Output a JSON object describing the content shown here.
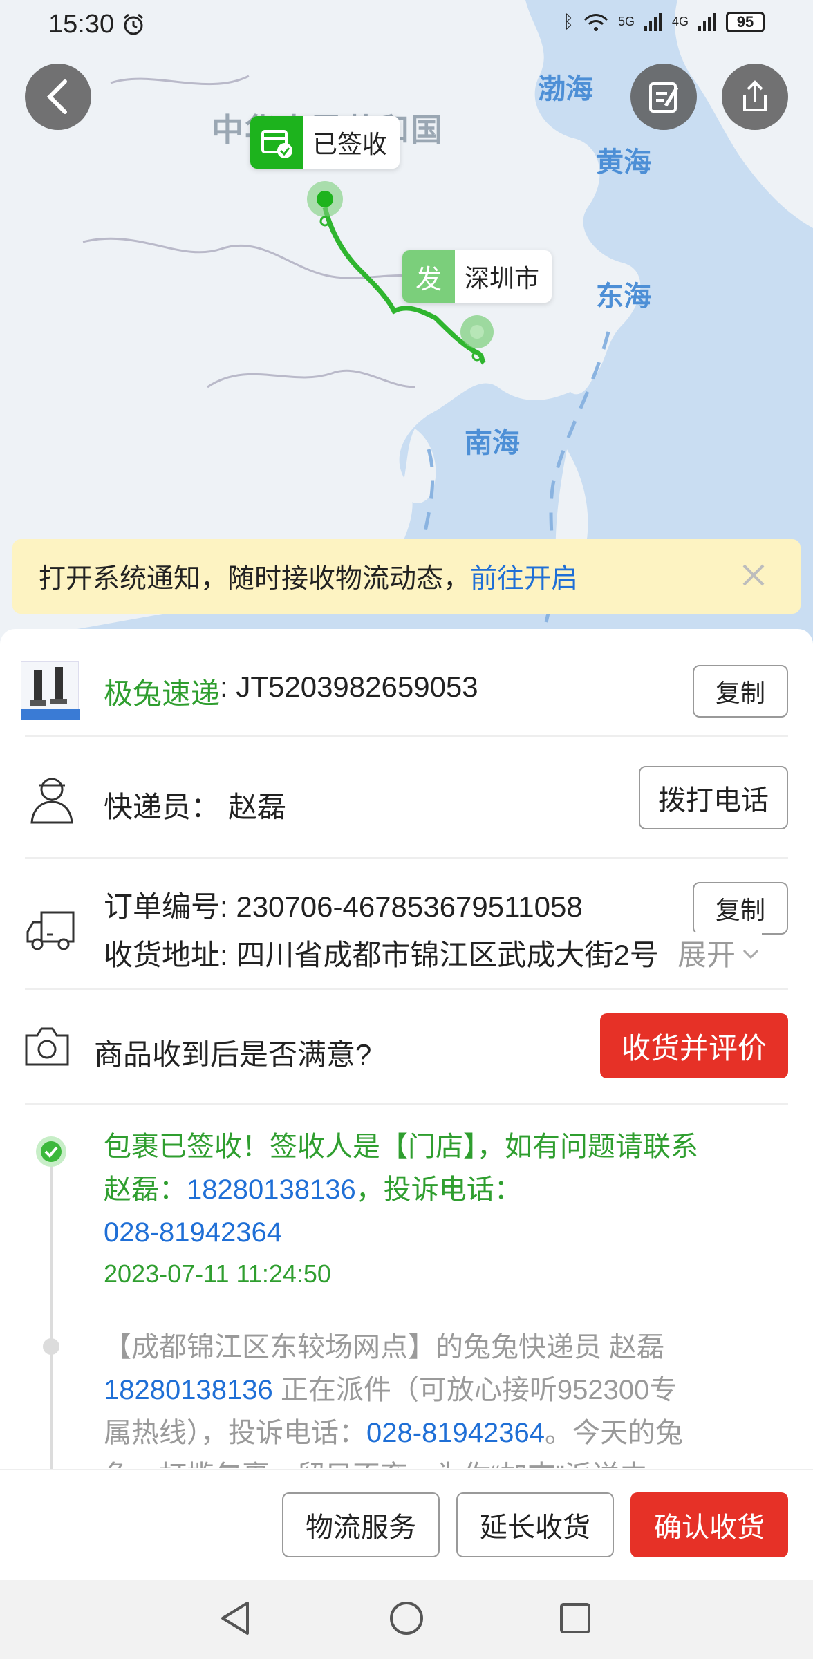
{
  "status_bar": {
    "time": "15:30",
    "signal_1": "5G",
    "signal_2": "4G",
    "battery": "95"
  },
  "map": {
    "country_label": "中华人民共和国",
    "sea_labels": [
      "渤海",
      "黄海",
      "东海",
      "南海"
    ],
    "destination_pin": {
      "label": "已签收",
      "color": "#1db31d"
    },
    "origin_pin": {
      "tag": "发",
      "label": "深圳市",
      "color": "#7bcf7b"
    },
    "route_color": "#2fb52f"
  },
  "notice": {
    "text": "打开系统通知，随时接收物流动态，",
    "link": "前往开启"
  },
  "courier_company": {
    "name": "极兔速递",
    "tracking_number": ": JT5203982659053",
    "copy_label": "复制"
  },
  "courier": {
    "label": "快递员：",
    "name": "赵磊",
    "call_label": "拨打电话"
  },
  "order": {
    "order_no_label": "订单编号: ",
    "order_no": "230706-467853679511058",
    "copy_label": "复制",
    "address_label": "收货地址: ",
    "address": "四川省成都市锦江区武成大街2号",
    "expand_label": "展开"
  },
  "review": {
    "question": "商品收到后是否满意?",
    "button": "收货并评价"
  },
  "timeline": [
    {
      "line1": "包裹已签收！签收人是【门店】，如有问题请联系",
      "line2_a": "赵磊：",
      "phone1": "18280138136",
      "line2_b": "，投诉电话：",
      "phone2": "028-81942364",
      "time": "2023-07-11 11:24:50"
    },
    {
      "line1": "【成都锦江区东较场网点】的兔兔快递员 赵磊",
      "phone1": "18280138136",
      "line2_b": " 正在派件（可放心接听952300专",
      "line3_a": "属热线），投诉电话：",
      "phone2": "028-81942364",
      "line3_b": "。今天的兔",
      "line4": "兔，打揽包裹，留只不弃，为你“加志”派送中"
    }
  ],
  "bottom_buttons": {
    "logistics": "物流服务",
    "extend": "延长收货",
    "confirm": "确认收货"
  },
  "colors": {
    "primary_red": "#e63127",
    "link_blue": "#1f6fd6",
    "status_green": "#2f9e2f"
  }
}
